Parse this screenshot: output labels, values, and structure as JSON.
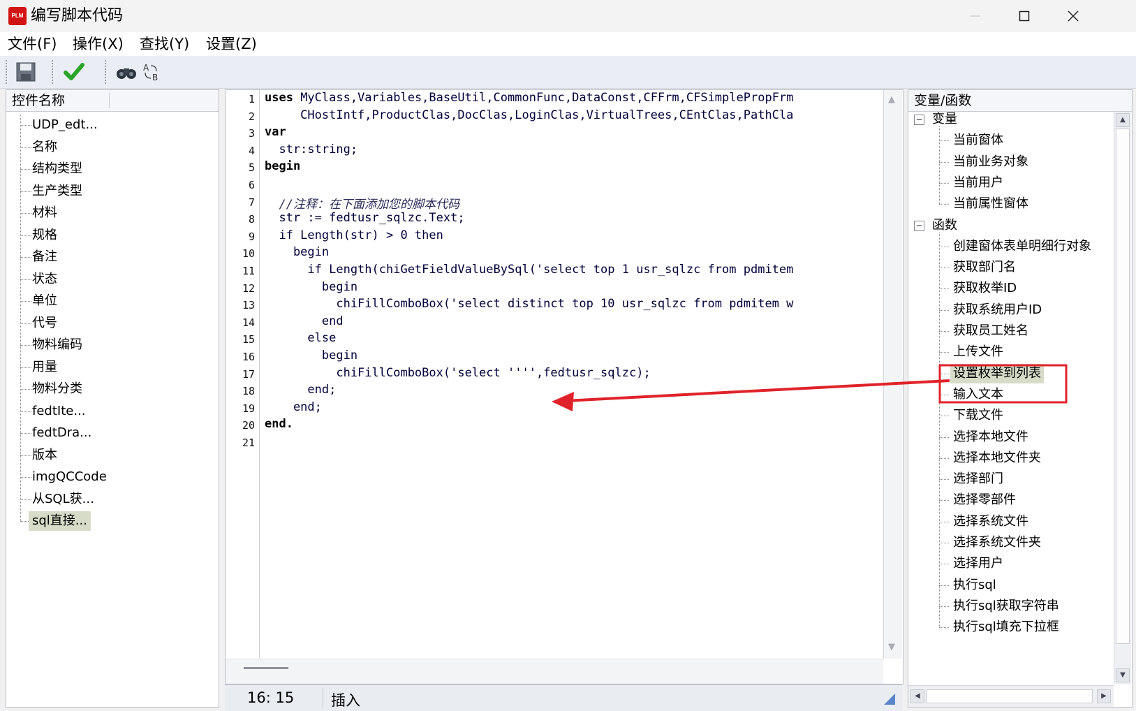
{
  "window": {
    "logo_text": "PLM",
    "title": "编写脚本代码"
  },
  "menu": [
    "文件(F)",
    "操作(X)",
    "查找(Y)",
    "设置(Z)"
  ],
  "left_panel": {
    "header": "控件名称",
    "items": [
      "UDP_edt...",
      "名称",
      "结构类型",
      "生产类型",
      "材料",
      "规格",
      "备注",
      "状态",
      "单位",
      "代号",
      "物料编码",
      "用量",
      "物料分类",
      "fedtIte...",
      "fedtDra...",
      "版本",
      "imgQCCode",
      "从SQL获...",
      "sql直接..."
    ],
    "selected_index": 18
  },
  "code": {
    "line_numbers": [
      "1",
      "2",
      "3",
      "4",
      "5",
      "6",
      "7",
      "8",
      "9",
      "10",
      "11",
      "12",
      "13",
      "14",
      "15",
      "16",
      "17",
      "18",
      "19",
      "20",
      "21"
    ],
    "lines": [
      {
        "kw": "uses",
        "text": " MyClass,Variables,BaseUtil,CommonFunc,DataConst,CFFrm,CFSimplePropFrm"
      },
      {
        "kw": "",
        "text": "     CHostIntf,ProductClas,DocClas,LoginClas,VirtualTrees,CEntClas,PathCla"
      },
      {
        "kw": "var",
        "text": ""
      },
      {
        "kw": "",
        "text": "  str:string;"
      },
      {
        "kw": "begin",
        "text": ""
      },
      {
        "kw": "",
        "text": ""
      },
      {
        "kw": "",
        "text": "  //注释：在下面添加您的脚本代码",
        "comment": true
      },
      {
        "kw": "",
        "text": "  str := fedtusr_sqlzc.Text;"
      },
      {
        "kw": "",
        "text": "  if Length(str) > 0 then"
      },
      {
        "kw": "",
        "text": "    begin"
      },
      {
        "kw": "",
        "text": "      if Length(chiGetFieldValueBySql('select top 1 usr_sqlzc from pdmitem"
      },
      {
        "kw": "",
        "text": "        begin"
      },
      {
        "kw": "",
        "text": "          chiFillComboBox('select distinct top 10 usr_sqlzc from pdmitem w"
      },
      {
        "kw": "",
        "text": "        end"
      },
      {
        "kw": "",
        "text": "      else"
      },
      {
        "kw": "",
        "text": "        begin"
      },
      {
        "kw": "",
        "text": "          chiFillComboBox('select '''',fedtusr_sqlzc);"
      },
      {
        "kw": "",
        "text": "      end;"
      },
      {
        "kw": "",
        "text": "    end;"
      },
      {
        "kw": "end.",
        "text": ""
      },
      {
        "kw": "",
        "text": ""
      }
    ]
  },
  "status": {
    "position": "16: 15",
    "mode": "插入"
  },
  "right_panel": {
    "header": "变量/函数",
    "groups": [
      {
        "label": "变量",
        "items": [
          "当前窗体",
          "当前业务对象",
          "当前用户",
          "当前属性窗体"
        ]
      },
      {
        "label": "函数",
        "items": [
          "创建窗体表单明细行对象",
          "获取部门名",
          "获取枚举ID",
          "获取系统用户ID",
          "获取员工姓名",
          "上传文件",
          "设置枚举到列表",
          "输入文本",
          "下载文件",
          "选择本地文件",
          "选择本地文件夹",
          "选择部门",
          "选择零部件",
          "选择系统文件",
          "选择系统文件夹",
          "选择用户",
          "执行sql",
          "执行sql获取字符串",
          "执行sql填充下拉框"
        ]
      }
    ],
    "highlighted": "设置枚举到列表"
  },
  "colors": {
    "annotation": "#e0232a",
    "selection": "#d6dcc8"
  }
}
